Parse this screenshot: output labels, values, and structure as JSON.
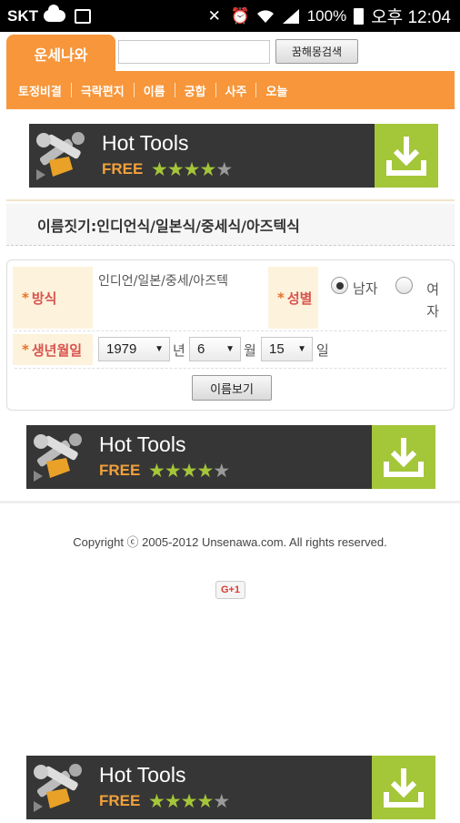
{
  "status_bar": {
    "carrier": "SKT",
    "battery": "100%",
    "time": "오후 12:04"
  },
  "header": {
    "logo": "운세나와",
    "search_placeholder": "",
    "search_button": "꿈해몽검색"
  },
  "nav": {
    "items": [
      "토정비결",
      "극락편지",
      "이름",
      "궁합",
      "사주",
      "오늘"
    ]
  },
  "ads": {
    "title": "Hot Tools",
    "free": "FREE",
    "stars": "★★★★",
    "star_empty": "★",
    "accent_color": "#a4c639",
    "dark_color": "#363636"
  },
  "page": {
    "title": "이름짓기:인디언식/일본식/중세식/아즈텍식"
  },
  "form": {
    "method_label": "방식",
    "method_value": "인디언/일본/중세/아즈텍",
    "gender_label": "성별",
    "gender_male": "남자",
    "gender_female": "여자",
    "gender_selected": "남자",
    "birth_label": "생년월일",
    "year": "1979",
    "year_unit": "년",
    "month": "6",
    "month_unit": "월",
    "day": "15",
    "day_unit": "일",
    "required_mark": "*",
    "submit": "이름보기"
  },
  "footer": {
    "copyright": "Copyright ⓒ 2005-2012 Unsenawa.com. All rights reserved.",
    "gplus": "G+1"
  },
  "theme": {
    "orange": "#f7963a",
    "label_bg": "#fdf3dc"
  }
}
